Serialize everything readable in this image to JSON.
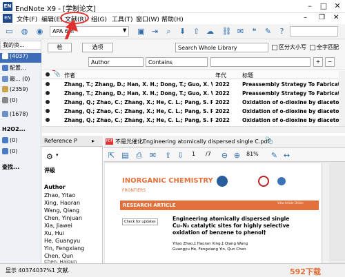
{
  "window": {
    "title": "EndNote X9 - [学制论文]",
    "app_icon": "EN"
  },
  "menu": [
    "文件(F)",
    "编辑(E)",
    "文献(R)",
    "组(G)",
    "工具(T)",
    "窗口(W)",
    "帮助(H)"
  ],
  "toolbar": {
    "style": "APA 6th"
  },
  "sidebar": {
    "header": "我的资...",
    "items": [
      {
        "label": "(4037)",
        "selected": true
      },
      {
        "label": "配置..."
      },
      {
        "label": "最...  (0)"
      },
      {
        "label": "(2359)"
      },
      {
        "label": "(0)"
      },
      {
        "label": "(1678)"
      }
    ],
    "group1": "H2O2...",
    "group1_items": [
      "(0)",
      "(0)"
    ],
    "group2": "查找..."
  },
  "search": {
    "simple_button": "检",
    "options_button": "选项",
    "scope": "Search Whole Library",
    "match_case": "区分大小写",
    "match_words": "全字匹配",
    "field": "Author",
    "operator": "Contains"
  },
  "table": {
    "columns": [
      "作者",
      "年代",
      "标题"
    ],
    "rows": [
      {
        "author": "Zhang, T.; Zhang, D.; Han, X. H.; Dong, T.; Guo, X. W.; So...",
        "year": "2022",
        "title": "Preassembly Strategy To Fabricate"
      },
      {
        "author": "Zhang, T.; Zhang, D.; Han, X. H.; Dong, T.; Guo, X. W.; So...",
        "year": "2022",
        "title": "Preassembly Strategy To Fabricate"
      },
      {
        "author": "Zhang, Q.; Zhao, C.; Zhang, X.; He, C. L.; Pang, S. P.",
        "year": "2022",
        "title": "Oxidation of o-dioxine by diaceto"
      },
      {
        "author": "Zhang, Q.; Zhao, C.; Zhang, X.; He, C. L.; Pang, S. P.",
        "year": "2022",
        "title": "Oxidation of o-dioxine by diaceto"
      },
      {
        "author": "Zhang, Q.; Zhao, C.; Zhang, X.; He, C. L.; Pang, S. P.",
        "year": "2022",
        "title": "Oxidation of o-dioxine by diaceto"
      }
    ]
  },
  "reference_panel": {
    "tab1": "Reference",
    "tab2": "P",
    "label": "评级",
    "field": "Author",
    "authors": [
      "Zhao, Yitao",
      "Xing, Haoran",
      "Wang, Qiang",
      "Chen, Yinjuan",
      "Xia, Jiawei",
      "Xu, Hui",
      "He, Guangyu",
      "Yin, Fengxiang",
      "Chen, Qun",
      "Chen, Haiqun"
    ]
  },
  "pdf": {
    "tab_title": "不是光催化Engineering atomically dispersed single C.pdf",
    "page_current": "1",
    "page_total": "/7",
    "zoom": "81%",
    "journal": "INORGANIC CHEMISTRY",
    "journal_sub": "FRONTIERS",
    "banner": "RESEARCH ARTICLE",
    "banner_right": "View Article Online",
    "check_updates": "Check for updates",
    "article_title": "Engineering atomically dispersed single Cu–N₃ catalytic sites for highly selective oxidation of benzene to phenol†",
    "authors_line": "Yitao Zhao,‡ Haoran Xing,‡ Qiang Wang",
    "authors_line2": "Guangyu He, Fengxiang Yin, Qun Chen"
  },
  "status": {
    "text": "显示 40374037%1 文献."
  },
  "watermark": "592下载",
  "colors": {
    "annotation": "#e0302e",
    "accent": "#2b6cb0",
    "journal": "#e2703a",
    "banner": "#e2703a"
  }
}
